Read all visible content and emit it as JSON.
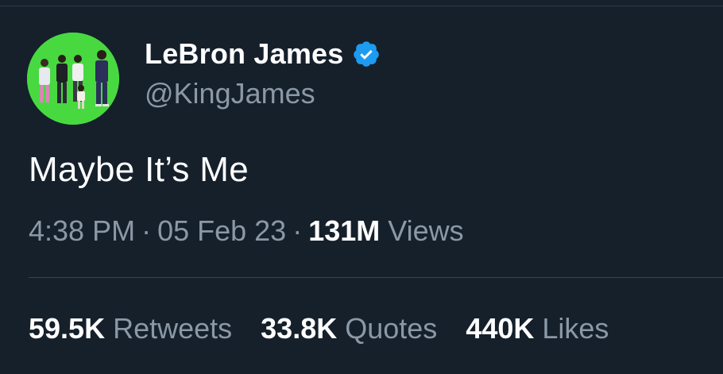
{
  "colors": {
    "background": "#15202b",
    "text_primary": "#ffffff",
    "text_secondary": "#8b98a5",
    "verified_badge": "#1d9bf0",
    "avatar_background": "#46d63d"
  },
  "author": {
    "display_name": "LeBron James",
    "handle": "@KingJames",
    "verified_icon": "verified-badge-icon",
    "avatar_icon": "profile-photo"
  },
  "tweet": {
    "text": "Maybe It’s Me",
    "time": "4:38 PM",
    "date": "05 Feb 23",
    "separator": "·",
    "views_count": "131M",
    "views_label": "Views"
  },
  "engagement": {
    "retweets_count": "59.5K",
    "retweets_label": "Retweets",
    "quotes_count": "33.8K",
    "quotes_label": "Quotes",
    "likes_count": "440K",
    "likes_label": "Likes"
  }
}
